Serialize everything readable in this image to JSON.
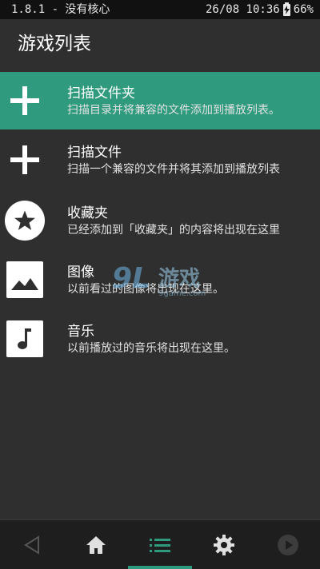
{
  "status_bar": {
    "left_text": "1.8.1 - 没有核心",
    "datetime": "26/08 10:36",
    "battery": "66%"
  },
  "app_bar": {
    "title": "游戏列表"
  },
  "list": [
    {
      "title": "扫描文件夹",
      "subtitle": "扫描目录并将兼容的文件添加到播放列表。",
      "icon": "plus-icon",
      "selected": true
    },
    {
      "title": "扫描文件",
      "subtitle": "扫描一个兼容的文件并将其添加到播放列表",
      "icon": "plus-icon",
      "selected": false
    },
    {
      "title": "收藏夹",
      "subtitle": "已经添加到「收藏夹」的内容将出现在这里",
      "icon": "star-icon",
      "selected": false
    },
    {
      "title": "图像",
      "subtitle": "以前看过的图像将出现在这里。",
      "icon": "image-icon",
      "selected": false
    },
    {
      "title": "音乐",
      "subtitle": "以前播放过的音乐将出现在这里。",
      "icon": "music-note-icon",
      "selected": false
    }
  ],
  "watermark": {
    "logo": "9L",
    "text": "游戏",
    "url": "9game.com"
  },
  "nav": {
    "items": [
      "back-icon",
      "home-icon",
      "list-icon",
      "settings-icon",
      "play-icon"
    ],
    "active_index": 2
  },
  "colors": {
    "accent": "#2f9a7d",
    "background": "#2f2f2f",
    "status_bar": "#111111",
    "nav_bar": "#1e1e1e"
  }
}
